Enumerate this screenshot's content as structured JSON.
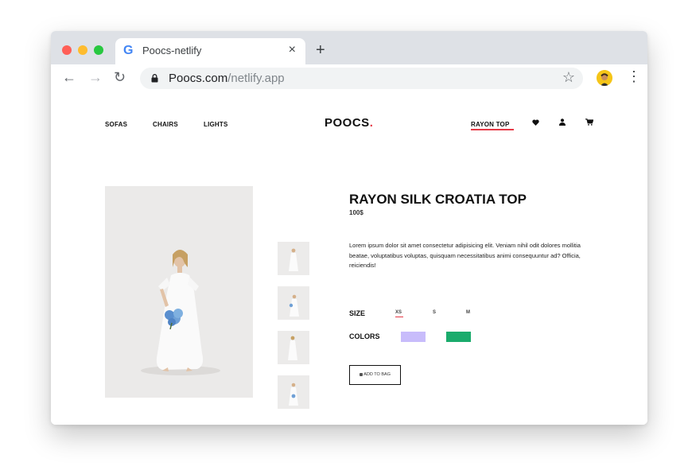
{
  "browser": {
    "tab_title": "Poocs-netlify",
    "url_domain": "Poocs.com",
    "url_path": "/netlify.app",
    "traffic_light_colors": [
      "#ff5f57",
      "#febc2e",
      "#28c840"
    ]
  },
  "site": {
    "nav": [
      "SOFAS",
      "CHAIRS",
      "LIGHTS"
    ],
    "logo": "POOCS",
    "logo_dot": ".",
    "active_link": "RAYON TOP",
    "accent": "#e63946",
    "icons": [
      "heart-icon",
      "user-icon",
      "cart-icon"
    ]
  },
  "product": {
    "title": "RAYON SILK CROATIA TOP",
    "price": "100$",
    "description": "Lorem ipsum dolor sit amet consectetur adipisicing elit. Veniam nihil odit dolores mollitia beatae, voluptatibus voluptas, quisquam necessitatibus animi consequuntur ad? Officia, reiciendis!",
    "size_label": "SIZE",
    "sizes": [
      "XS",
      "S",
      "M"
    ],
    "selected_size": "XS",
    "colors_label": "COLORS",
    "colors": [
      "#c8bcfb",
      "#1aab6c"
    ],
    "add_to_bag": "ADD TO BAG"
  }
}
